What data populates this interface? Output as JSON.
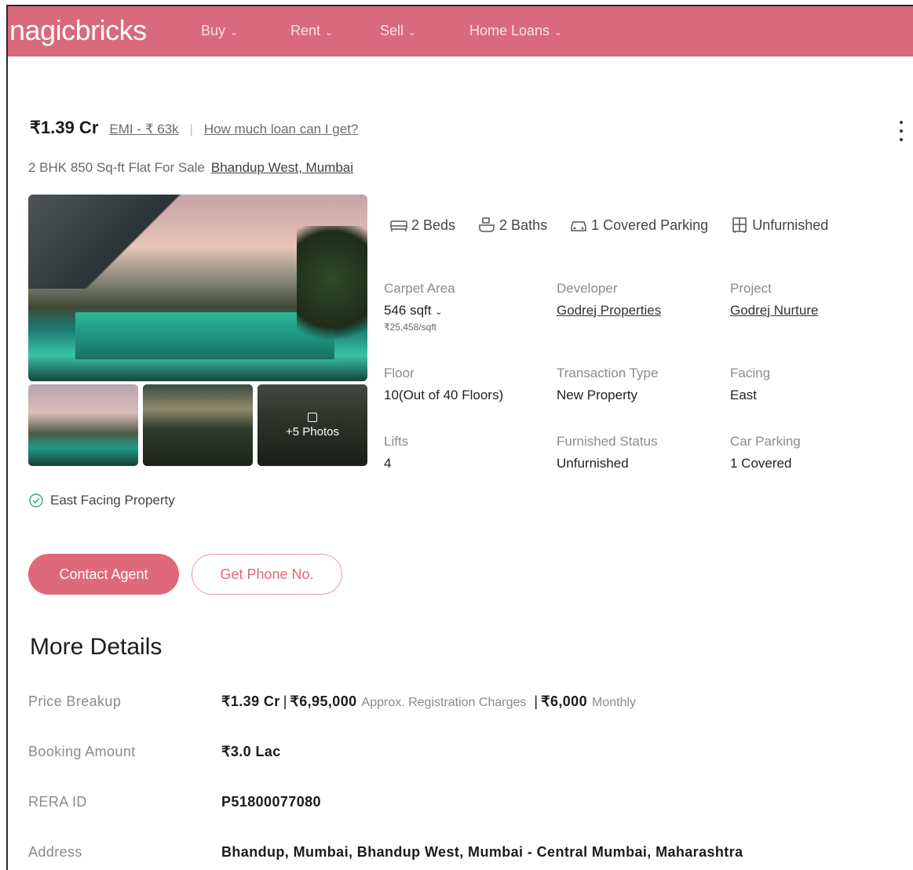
{
  "header": {
    "logo": "nagicbricks",
    "nav": [
      {
        "label": "Buy"
      },
      {
        "label": "Rent"
      },
      {
        "label": "Sell"
      },
      {
        "label": "Home Loans"
      }
    ]
  },
  "listing": {
    "price": "₹1.39 Cr",
    "emi": "EMI - ₹ 63k",
    "separator": "|",
    "loan_link": "How much loan can I get?",
    "title": "2 BHK 850 Sq-ft Flat For Sale",
    "location": "Bhandup West, Mumbai",
    "photos_more": "+5 Photos",
    "amenities": [
      {
        "icon": "bed-icon",
        "label": "2 Beds"
      },
      {
        "icon": "bath-icon",
        "label": "2 Baths"
      },
      {
        "icon": "car-icon",
        "label": "1 Covered Parking"
      },
      {
        "icon": "wardrobe-icon",
        "label": "Unfurnished"
      }
    ],
    "facts": {
      "carpet_area": {
        "label": "Carpet Area",
        "value": "546 sqft",
        "sub": "₹25,458/sqft"
      },
      "developer": {
        "label": "Developer",
        "value": "Godrej Properties"
      },
      "project": {
        "label": "Project",
        "value": "Godrej Nurture"
      },
      "floor": {
        "label": "Floor",
        "value": "10(Out of 40 Floors)"
      },
      "transaction_type": {
        "label": "Transaction Type",
        "value": "New Property"
      },
      "facing": {
        "label": "Facing",
        "value": "East"
      },
      "lifts": {
        "label": "Lifts",
        "value": "4"
      },
      "furnished_status": {
        "label": "Furnished Status",
        "value": "Unfurnished"
      },
      "car_parking": {
        "label": "Car Parking",
        "value": "1 Covered"
      }
    },
    "facing_note": "East Facing Property",
    "buttons": {
      "contact": "Contact Agent",
      "phone": "Get Phone No."
    }
  },
  "more_details": {
    "title": "More Details",
    "price_breakup": {
      "label": "Price Breakup",
      "price": "₹1.39 Cr",
      "registration_value": "₹6,95,000",
      "registration_note": "Approx. Registration Charges",
      "maintenance_value": "₹6,000",
      "maintenance_note": "Monthly"
    },
    "booking_amount": {
      "label": "Booking Amount",
      "value": "₹3.0 Lac"
    },
    "rera_id": {
      "label": "RERA ID",
      "value": "P51800077080"
    },
    "address": {
      "label": "Address",
      "value": "Bhandup, Mumbai, Bhandup West, Mumbai - Central Mumbai, Maharashtra"
    }
  },
  "colors": {
    "brand": "#d9697c",
    "button": "#e0687b",
    "success": "#3fb06a"
  }
}
